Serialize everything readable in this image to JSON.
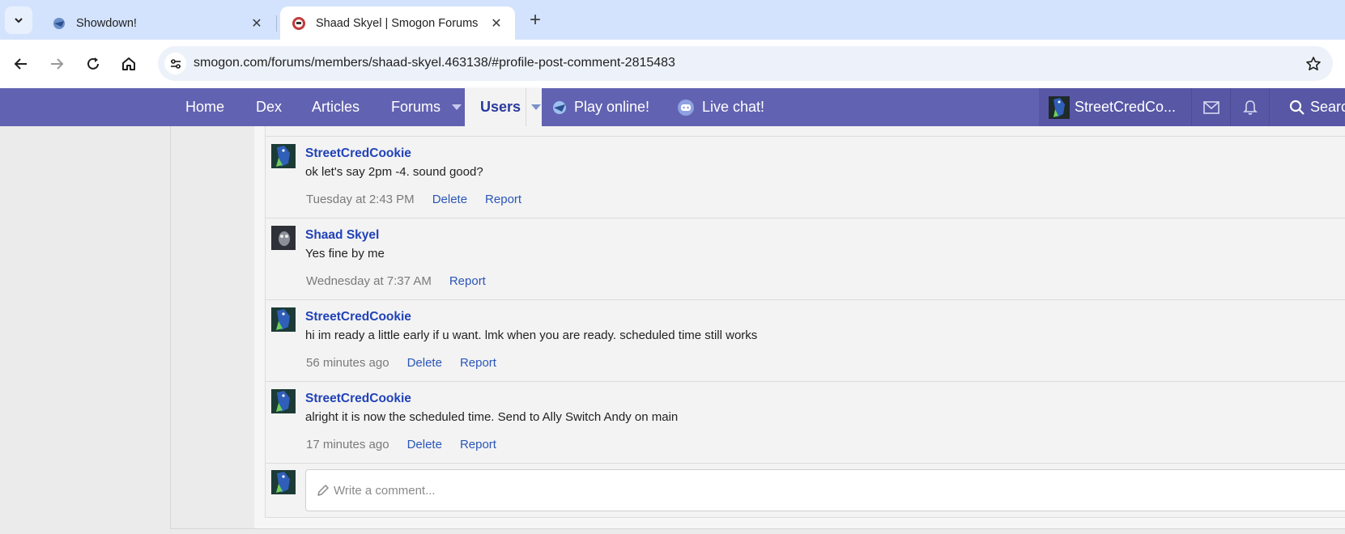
{
  "browser": {
    "tabs": [
      {
        "title": "Showdown!",
        "active": false
      },
      {
        "title": "Shaad Skyel | Smogon Forums",
        "active": true
      }
    ],
    "url": "smogon.com/forums/members/shaad-skyel.463138/#profile-post-comment-2815483"
  },
  "nav": {
    "items": [
      "Home",
      "Dex",
      "Articles",
      "Forums",
      "Users",
      "Play online!",
      "Live chat!"
    ],
    "account": "StreetCredCo...",
    "search": "Search",
    "colors": {
      "bar": "#6262b2",
      "active_tab_text": "#2a3a9c"
    }
  },
  "comments": [
    {
      "author": "StreetCredCookie",
      "text": "ok let's say 2pm -4. sound good?",
      "time": "Tuesday at 2:43 PM",
      "actions": [
        "Delete",
        "Report"
      ]
    },
    {
      "author": "Shaad Skyel",
      "text": "Yes fine by me",
      "time": "Wednesday at 7:37 AM",
      "actions": [
        "Report"
      ]
    },
    {
      "author": "StreetCredCookie",
      "text": "hi im ready a little early if u want. lmk when you are ready. scheduled time still works",
      "time": "56 minutes ago",
      "actions": [
        "Delete",
        "Report"
      ]
    },
    {
      "author": "StreetCredCookie",
      "text": "alright it is now the scheduled time. Send to Ally Switch Andy on main",
      "time": "17 minutes ago",
      "actions": [
        "Delete",
        "Report"
      ]
    }
  ],
  "composer": {
    "placeholder": "Write a comment..."
  }
}
